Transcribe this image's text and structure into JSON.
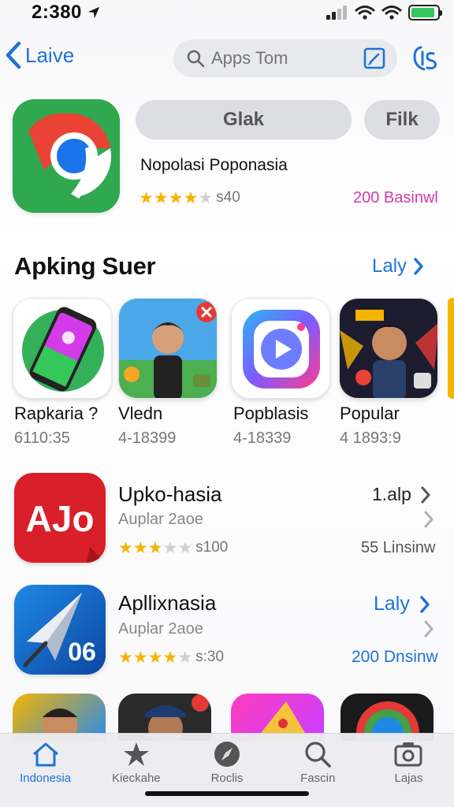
{
  "status_bar": {
    "time": "2:380",
    "battery_level": 0.9
  },
  "nav": {
    "back_label": "Laive",
    "search_placeholder": "Apps Tom"
  },
  "featured": {
    "title": "Nopolasi Poponasia",
    "get_label": "Glak",
    "secondary_label": "Filk",
    "rating_stars": 4,
    "rating_count": "s40",
    "downloads": "200 Basinwl",
    "icon": "chrome-logo"
  },
  "section": {
    "title": "Apking Suer",
    "see_all_label": "Laly"
  },
  "grid": [
    {
      "name": "Rapkaria ?",
      "sub": "6110:35",
      "icon": "phone-chat"
    },
    {
      "name": "Vledn",
      "sub": "4-18399",
      "icon": "kid-photo"
    },
    {
      "name": "Popblasis",
      "sub": "4-18339",
      "icon": "play-camera"
    },
    {
      "name": "Popular",
      "sub": "4 1893:9",
      "icon": "kid-game"
    }
  ],
  "list": [
    {
      "title": "Upko-hasia",
      "action": "1.alp",
      "sub": "Auplar 2aoe",
      "rating_stars": 3,
      "rating_count": "s100",
      "downloads": "55 Linsinw",
      "accent": "#333333",
      "icon": "ajo-logo",
      "icon_text": "AJo"
    },
    {
      "title": "Apllixnasia",
      "action": "Laly",
      "sub": "Auplar 2aoe",
      "rating_stars": 4,
      "rating_count": "s:30",
      "downloads": "200 Dnsinw",
      "accent": "#1e73d6",
      "icon": "paper-plane-logo",
      "icon_text": "06"
    }
  ],
  "tabs": [
    {
      "label": "Indonesia",
      "icon": "home-icon",
      "active": true
    },
    {
      "label": "Kieckahe",
      "icon": "star-icon",
      "active": false
    },
    {
      "label": "Roclis",
      "icon": "compass-icon",
      "active": false
    },
    {
      "label": "Fascin",
      "icon": "search-icon",
      "active": false
    },
    {
      "label": "Lajas",
      "icon": "camera-icon",
      "active": false
    }
  ],
  "colors": {
    "accent_blue": "#1e73d6",
    "star_gold": "#f5b400",
    "magenta": "#d23aa8"
  }
}
